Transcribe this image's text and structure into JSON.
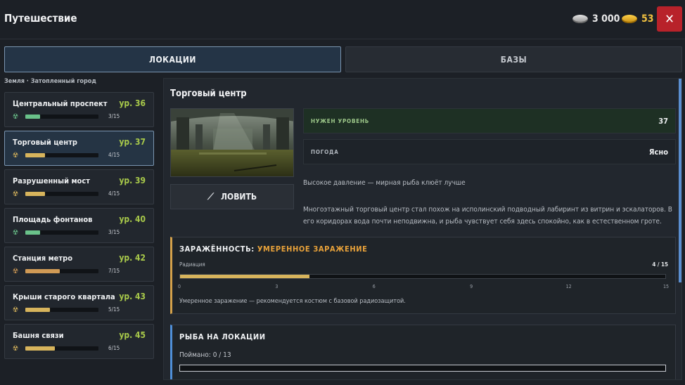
{
  "header": {
    "title": "Путешествие",
    "silver": "3 000",
    "gold": "53"
  },
  "tabs": [
    {
      "label": "ЛОКАЦИИ",
      "active": true
    },
    {
      "label": "БАЗЫ",
      "active": false
    }
  ],
  "breadcrumb": "Земля · Затопленный город",
  "locations": [
    {
      "name": "Центральный проспект",
      "level": "ур. 36",
      "count": "3/15",
      "progress": 0.2,
      "color": "#6ac28a"
    },
    {
      "name": "Торговый центр",
      "level": "ур. 37",
      "count": "4/15",
      "progress": 0.267,
      "color": "#d7b45c",
      "selected": true
    },
    {
      "name": "Разрушенный мост",
      "level": "ур. 39",
      "count": "4/15",
      "progress": 0.267,
      "color": "#d7b45c"
    },
    {
      "name": "Площадь фонтанов",
      "level": "ур. 40",
      "count": "3/15",
      "progress": 0.2,
      "color": "#6ac28a"
    },
    {
      "name": "Станция метро",
      "level": "ур. 42",
      "count": "7/15",
      "progress": 0.467,
      "color": "#d09a55"
    },
    {
      "name": "Крыши старого квартала",
      "level": "ур. 43",
      "count": "5/15",
      "progress": 0.333,
      "color": "#d7b45c"
    },
    {
      "name": "Башня связи",
      "level": "ур. 45",
      "count": "6/15",
      "progress": 0.4,
      "color": "#d7b45c"
    }
  ],
  "detail": {
    "title": "Торговый центр",
    "fish_button": "ЛОВИТЬ",
    "level_label": "НУЖЕН УРОВЕНЬ",
    "level_value": "37",
    "weather_label": "ПОГОДА",
    "weather_value": "Ясно",
    "desc_short": "Высокое давление — мирная рыба клюёт лучше",
    "desc_long": "Многоэтажный торговый центр стал похож на исполинский подводный лабиринт из витрин и эскалаторов. В его коридорах вода почти неподвижна, и рыба чувствует себя здесь спокойно, как в естественном гроте."
  },
  "contamination": {
    "title_prefix": "ЗАРАЖЁННОСТЬ:",
    "title_value": "УМЕРЕННОЕ ЗАРАЖЕНИЕ",
    "radiation_label": "Радиация",
    "radiation_count": "4 / 15",
    "radiation_progress": 0.267,
    "ticks": [
      "0",
      "3",
      "6",
      "9",
      "12",
      "15"
    ],
    "description": "Умеренное заражение — рекомендуется костюм с базовой радиозащитой."
  },
  "fish_panel": {
    "title": "РЫБА НА ЛОКАЦИИ",
    "caught": "Поймано: 0 / 13",
    "progress": 0
  },
  "icons": {
    "radiation": "radiation-icon",
    "close": "close-icon",
    "rod": "fishing-rod-icon",
    "silver_coin": "silver-coin-icon",
    "gold_coin": "gold-coin-icon"
  }
}
